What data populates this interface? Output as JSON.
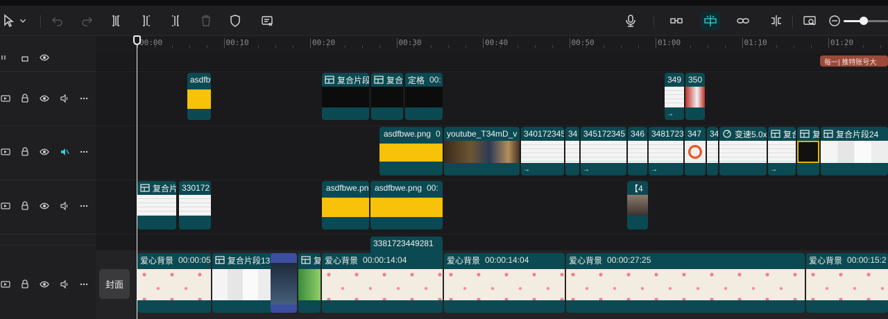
{
  "toolbar": {
    "tools_left": [
      "select-tool",
      "dropdown",
      "undo",
      "redo",
      "split",
      "split-left",
      "split-right",
      "delete",
      "mark",
      "auto-caption"
    ],
    "tools_right": [
      "microphone",
      "link-main",
      "magnet-snap",
      "link-clips",
      "split-preview",
      "preview-quality",
      "zoom-out"
    ],
    "zoom_level": 0.45
  },
  "ruler": {
    "labels": [
      "00:00",
      "00:10",
      "00:20",
      "00:30",
      "00:40",
      "00:50",
      "01:00",
      "01:10",
      "01:20"
    ]
  },
  "tracks": {
    "cover_label": "封面",
    "marker_text": "每一| 推特账号大"
  },
  "clips": {
    "v5_a": "asdfbwe.png",
    "v5_b": "复合片段",
    "v5_c": "复合",
    "v5_d": "定格",
    "v5_e": "00:",
    "v5_f": "349",
    "v5_g": "350",
    "v4_a": "asdfbwe.png",
    "v4_a_dur": "0",
    "v4_b": "youtube_T34mD_v",
    "v4_c": "340172345",
    "v4_d": "34",
    "v4_e": "345172345",
    "v4_f": "346",
    "v4_g": "3481723",
    "v4_h": "347",
    "v4_i": "34",
    "v4_j": "变速5.0x",
    "v4_k": "复合",
    "v4_l": "复",
    "v4_m": "复合片段24",
    "v3_a": "复合片",
    "v3_b": "330172",
    "v3_c": "asdfbwe.png",
    "v3_d": "asdfbwe.png",
    "v3_d_dur": "00:",
    "v3_e": "【4",
    "v2_a": "3381723449281",
    "m_a": "爱心背景",
    "m_a_dur": "00:00:05",
    "m_b": "复合片段13",
    "m_c": "复",
    "m_d": "爱心背景",
    "m_d_dur": "00:00:14:04",
    "m_e": "爱心背景",
    "m_e_dur": "00:00:14:04",
    "m_f": "爱心背景",
    "m_f_dur": "00:00:27:25",
    "m_g": "爱心背景",
    "m_g_dur": "00:00:15:2"
  },
  "colors": {
    "clip": "#0b4a52",
    "accent": "#37c8d8",
    "yellow": "#f8c10a"
  }
}
